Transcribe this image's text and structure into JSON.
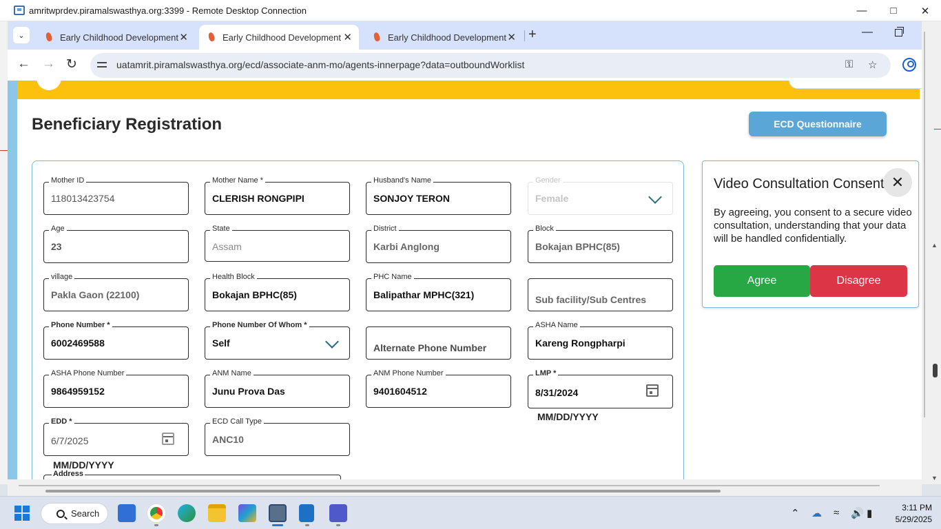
{
  "rdp": {
    "title": "amritwprdev.piramalswasthya.org:3399 - Remote Desktop Connection"
  },
  "browser": {
    "tabs": [
      {
        "label": "Early Childhood Development"
      },
      {
        "label": "Early Childhood Development"
      },
      {
        "label": "Early Childhood Development"
      }
    ],
    "url": "uatamrit.piramalswasthya.org/ecd/associate-anm-mo/agents-innerpage?data=outboundWorklist"
  },
  "page": {
    "title": "Beneficiary Registration",
    "ecd_button": "ECD Questionnaire",
    "fields": {
      "mother_id": {
        "label": "Mother ID",
        "value": "118013423754"
      },
      "mother_name": {
        "label": "Mother Name *",
        "value": "CLERISH RONGPIPI"
      },
      "husband_name": {
        "label": "Husband's Name",
        "value": "SONJOY TERON"
      },
      "gender": {
        "label": "Gender",
        "value": "Female"
      },
      "age": {
        "label": "Age",
        "value": "23"
      },
      "state": {
        "label": "State",
        "value": "Assam"
      },
      "district": {
        "label": "District",
        "value": "Karbi Anglong"
      },
      "block": {
        "label": "Block",
        "value": "Bokajan BPHC(85)"
      },
      "village": {
        "label": "village",
        "value": "Pakla Gaon  (22100)"
      },
      "health_block": {
        "label": "Health Block",
        "value": "Bokajan BPHC(85)"
      },
      "phc_name": {
        "label": "PHC Name",
        "value": "Balipathar MPHC(321)"
      },
      "sub_facility": {
        "placeholder": "Sub facility/Sub Centres"
      },
      "phone_number": {
        "label": "Phone Number *",
        "value": "6002469588"
      },
      "phone_of_whom": {
        "label": "Phone Number Of Whom *",
        "value": "Self"
      },
      "alternate_phone": {
        "placeholder": "Alternate Phone Number"
      },
      "asha_name": {
        "label": "ASHA Name",
        "value": "Kareng Rongpharpi"
      },
      "asha_phone": {
        "label": "ASHA Phone Number",
        "value": "9864959152"
      },
      "anm_name": {
        "label": "ANM Name",
        "value": "Junu Prova Das"
      },
      "anm_phone": {
        "label": "ANM Phone Number",
        "value": "9401604512"
      },
      "lmp": {
        "label": "LMP *",
        "value": "8/31/2024",
        "hint": "MM/DD/YYYY"
      },
      "edd": {
        "label": "EDD *",
        "value": "6/7/2025",
        "hint": "MM/DD/YYYY"
      },
      "ecd_call_type": {
        "label": "ECD Call Type",
        "value": "ANC10"
      },
      "address": {
        "label": "Address"
      }
    }
  },
  "consent": {
    "title": "Video Consultation Consent",
    "text": "By agreeing, you consent to a secure video consultation, understanding that your data will be handled confidentially.",
    "agree": "Agree",
    "disagree": "Disagree"
  },
  "taskbar": {
    "search_label": "Search",
    "time": "3:11 PM",
    "date": "5/29/2025"
  }
}
